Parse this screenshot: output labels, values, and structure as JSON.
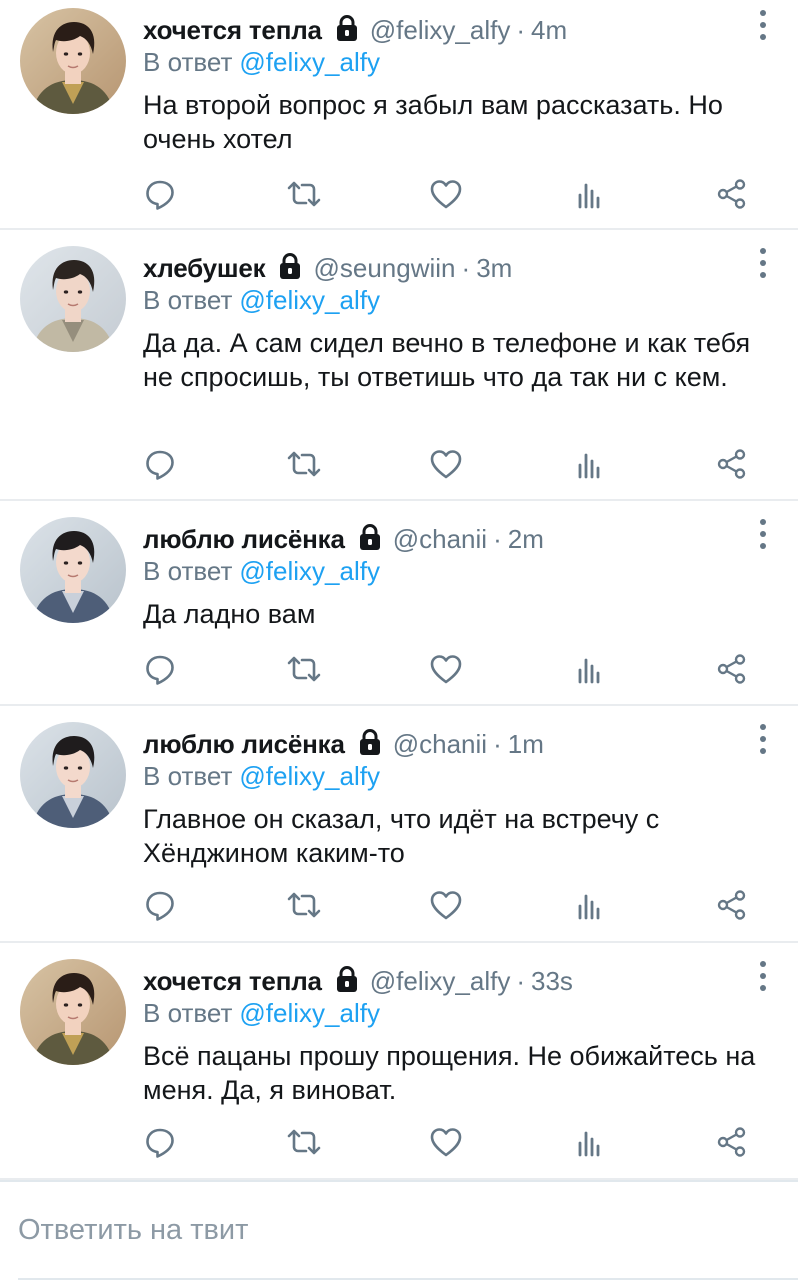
{
  "tweets": [
    {
      "name": "хочется тепла",
      "handle": "@felixy_alfy",
      "time": "4m",
      "reply_prefix": "В ответ",
      "reply_mention": "@felixy_alfy",
      "text": "На второй вопрос я забыл вам рассказать. Но очень хотел",
      "avatar": "avatar-felix"
    },
    {
      "name": "хлебушек",
      "handle": "@seungwiin",
      "time": "3m",
      "reply_prefix": "В ответ",
      "reply_mention": "@felixy_alfy",
      "text": "Да да. А сам сидел вечно в телефоне и как тебя не спросишь, ты ответишь что да так ни с кем.",
      "avatar": "avatar-seungmin"
    },
    {
      "name": "люблю лисёнка",
      "handle": "@chanii",
      "time": "2m",
      "reply_prefix": "В ответ",
      "reply_mention": "@felixy_alfy",
      "text": "Да ладно вам",
      "avatar": "avatar-chan"
    },
    {
      "name": "люблю лисёнка",
      "handle": "@chanii",
      "time": "1m",
      "reply_prefix": "В ответ",
      "reply_mention": "@felixy_alfy",
      "text": "Главное он сказал, что идёт на встречу с Хёнджином каким-то",
      "avatar": "avatar-chan"
    },
    {
      "name": "хочется тепла",
      "handle": "@felixy_alfy",
      "time": "33s",
      "reply_prefix": "В ответ",
      "reply_mention": "@felixy_alfy",
      "text": "Всё пацаны прошу прощения. Не обижайтесь на меня. Да, я виноват.",
      "avatar": "avatar-felix"
    }
  ],
  "icons": {
    "lock": "lock-icon",
    "more": "more-vertical-icon",
    "reply": "reply-icon",
    "retweet": "retweet-icon",
    "like": "heart-icon",
    "stats": "stats-icon",
    "share": "share-icon"
  },
  "colors": {
    "text": "#14171a",
    "secondary": "#657786",
    "link": "#1da1f2",
    "divider": "#e9ecef",
    "icon": "#657786"
  },
  "composer": {
    "placeholder": "Ответить на твит"
  }
}
